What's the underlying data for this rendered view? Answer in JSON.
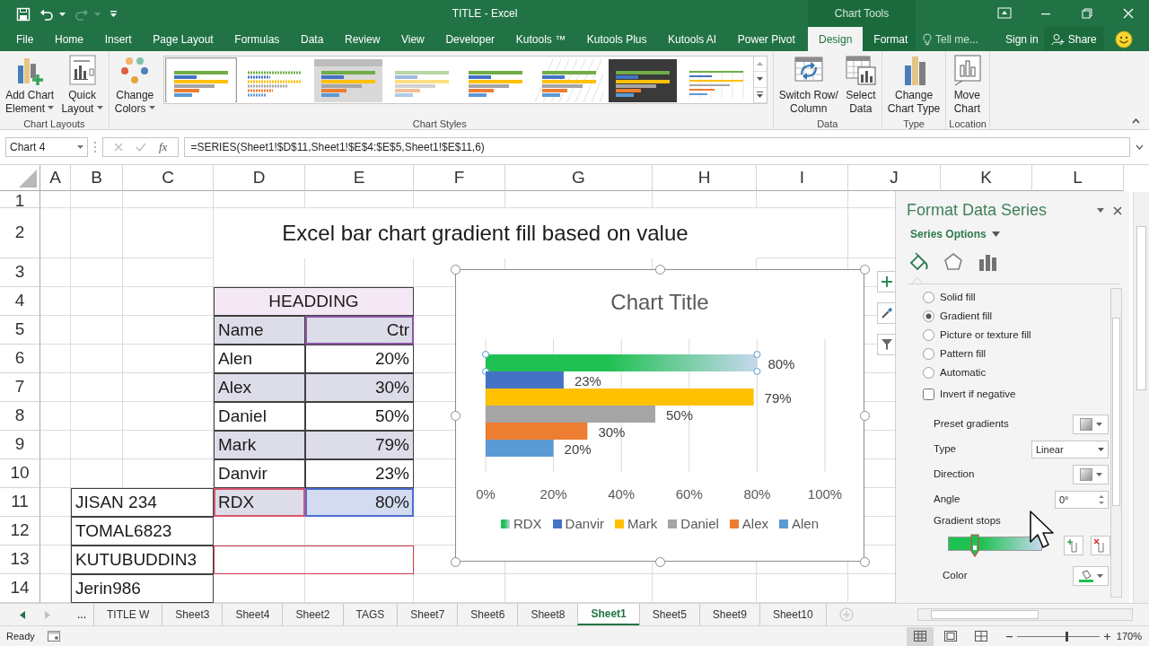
{
  "window": {
    "title": "TITLE - Excel",
    "context_title": "Chart Tools"
  },
  "quick_access": [
    {
      "kind": "save",
      "disabled": false
    },
    {
      "kind": "undo",
      "disabled": false
    },
    {
      "kind": "redo",
      "disabled": true
    },
    {
      "kind": "customize",
      "disabled": false
    }
  ],
  "window_controls": [
    {
      "kind": "ribbon-display"
    },
    {
      "kind": "minimize"
    },
    {
      "kind": "restore"
    },
    {
      "kind": "close"
    }
  ],
  "tabs": [
    {
      "label": "File",
      "kind": "file",
      "selected": false
    },
    {
      "label": "Home",
      "kind": "normal",
      "selected": false
    },
    {
      "label": "Insert",
      "kind": "normal",
      "selected": false
    },
    {
      "label": "Page Layout",
      "kind": "normal",
      "selected": false
    },
    {
      "label": "Formulas",
      "kind": "normal",
      "selected": false
    },
    {
      "label": "Data",
      "kind": "normal",
      "selected": false
    },
    {
      "label": "Review",
      "kind": "normal",
      "selected": false
    },
    {
      "label": "View",
      "kind": "normal",
      "selected": false
    },
    {
      "label": "Developer",
      "kind": "normal",
      "selected": false
    },
    {
      "label": "Kutools ™",
      "kind": "normal",
      "selected": false
    },
    {
      "label": "Kutools Plus",
      "kind": "normal",
      "selected": false
    },
    {
      "label": "Kutools AI",
      "kind": "normal",
      "selected": false
    },
    {
      "label": "Power Pivot",
      "kind": "normal",
      "selected": false
    },
    {
      "label": "Design",
      "kind": "context",
      "selected": true
    },
    {
      "label": "Format",
      "kind": "context",
      "selected": false
    }
  ],
  "tell_me": {
    "placeholder": "Tell me..."
  },
  "sign_in": "Sign in",
  "share": "Share",
  "ribbon": {
    "groups": [
      {
        "label": "Chart Layouts",
        "buttons": [
          {
            "kind": "add-element",
            "lines": [
              "Add Chart",
              "Element"
            ],
            "dropdown": true
          },
          {
            "kind": "quick-layout",
            "lines": [
              "Quick",
              "Layout"
            ],
            "dropdown": true
          }
        ]
      },
      {
        "label": "Chart Styles",
        "buttons": [
          {
            "kind": "change-colors",
            "lines": [
              "Change",
              "Colors"
            ],
            "dropdown": true
          }
        ],
        "gallery": [
          {
            "kind": "white",
            "selected": true
          },
          {
            "kind": "dotted",
            "selected": false
          },
          {
            "kind": "grey",
            "selected": false
          },
          {
            "kind": "pale",
            "selected": false
          },
          {
            "kind": "white",
            "selected": false
          },
          {
            "kind": "hatched",
            "selected": false
          },
          {
            "kind": "dark",
            "selected": false
          },
          {
            "kind": "thin",
            "selected": false
          }
        ]
      },
      {
        "label": "Data",
        "buttons": [
          {
            "kind": "switch-row",
            "lines": [
              "Switch Row/",
              "Column"
            ],
            "dropdown": false
          },
          {
            "kind": "select-data",
            "lines": [
              "Select",
              "Data"
            ],
            "dropdown": false
          }
        ]
      },
      {
        "label": "Type",
        "buttons": [
          {
            "kind": "change-type",
            "lines": [
              "Change",
              "Chart Type"
            ],
            "dropdown": false
          }
        ]
      },
      {
        "label": "Location",
        "buttons": [
          {
            "kind": "move-chart",
            "lines": [
              "Move",
              "Chart"
            ],
            "dropdown": false
          }
        ]
      }
    ]
  },
  "formula_bar": {
    "name_box": "Chart 4",
    "function_button": "fx",
    "formula": "=SERIES(Sheet1!$D$11,Sheet1!$E$4:$E$5,Sheet1!$E$11,6)"
  },
  "sheet": {
    "columns": [
      "A",
      "B",
      "C",
      "D",
      "E",
      "F",
      "G",
      "H",
      "I",
      "J",
      "K",
      "L"
    ],
    "rows": [
      "1",
      "2",
      "3",
      "4",
      "5",
      "6",
      "7",
      "8",
      "9",
      "10",
      "11",
      "12",
      "13",
      "14"
    ],
    "title": "Excel bar chart gradient fill based on value",
    "table": {
      "heading": "HEADDING",
      "columns": [
        "Name",
        "Ctr"
      ],
      "category_selected": true,
      "rows": [
        {
          "name": "Alen",
          "value": "20%",
          "band": false,
          "series_selected": false
        },
        {
          "name": "Alex",
          "value": "30%",
          "band": true,
          "series_selected": false
        },
        {
          "name": "Daniel",
          "value": "50%",
          "band": false,
          "series_selected": false
        },
        {
          "name": "Mark",
          "value": "79%",
          "band": true,
          "series_selected": false
        },
        {
          "name": "Danvir",
          "value": "23%",
          "band": false,
          "series_selected": false
        },
        {
          "name": "RDX",
          "value": "80%",
          "band": true,
          "series_selected": true
        }
      ]
    },
    "side_list": [
      "JISAN 234",
      "TOMAL6823",
      "KUTUBUDDIN3",
      "Jerin986"
    ]
  },
  "chart": {
    "chart_data": {
      "type": "bar",
      "orientation": "horizontal",
      "title": "Chart Title",
      "series": [
        {
          "name": "RDX",
          "color": "#1fc152",
          "values": [
            0.8
          ]
        },
        {
          "name": "Danvir",
          "color": "#4472c4",
          "values": [
            0.23
          ]
        },
        {
          "name": "Mark",
          "color": "#ffc000",
          "values": [
            0.79
          ]
        },
        {
          "name": "Daniel",
          "color": "#a5a5a5",
          "values": [
            0.5
          ]
        },
        {
          "name": "Alex",
          "color": "#ed7d31",
          "values": [
            0.3
          ]
        },
        {
          "name": "Alen",
          "color": "#5b9bd5",
          "values": [
            0.2
          ]
        }
      ],
      "xlim": [
        0,
        1
      ],
      "xticks": [
        {
          "value": 0,
          "label": "0%"
        },
        {
          "value": 0.2,
          "label": "20%"
        },
        {
          "value": 0.4,
          "label": "40%"
        },
        {
          "value": 0.6,
          "label": "60%"
        },
        {
          "value": 0.8,
          "label": "80%"
        },
        {
          "value": 1,
          "label": "100%"
        }
      ],
      "grid": true,
      "legend": "bottom",
      "value_labels": [
        "80%",
        "23%",
        "79%",
        "50%",
        "30%",
        "20%"
      ]
    },
    "series_styles": [
      {
        "kind": "gradient",
        "selected": true
      },
      {
        "kind": "solid",
        "selected": false
      },
      {
        "kind": "solid",
        "selected": false
      },
      {
        "kind": "solid",
        "selected": false
      },
      {
        "kind": "solid",
        "selected": false
      },
      {
        "kind": "solid",
        "selected": false
      }
    ],
    "selected": true,
    "buttons": [
      {
        "kind": "add"
      },
      {
        "kind": "style"
      },
      {
        "kind": "filter"
      }
    ]
  },
  "pane": {
    "title": "Format Data Series",
    "subtitle": "Series Options",
    "tabs": [
      {
        "kind": "fill",
        "selected": true
      },
      {
        "kind": "effects",
        "selected": false
      },
      {
        "kind": "options",
        "selected": false
      }
    ],
    "fill_options": [
      {
        "label": "Solid fill",
        "selected": false
      },
      {
        "label": "Gradient fill",
        "selected": true
      },
      {
        "label": "Picture or texture fill",
        "selected": false
      },
      {
        "label": "Pattern fill",
        "selected": false
      },
      {
        "label": "Automatic",
        "selected": false
      }
    ],
    "invert": {
      "label": "Invert if negative",
      "checked": false
    },
    "fields": [
      {
        "kind": "swatch",
        "label": "Preset gradients"
      },
      {
        "kind": "select",
        "label": "Type",
        "value": "Linear"
      },
      {
        "kind": "swatch",
        "label": "Direction"
      },
      {
        "kind": "spin",
        "label": "Angle",
        "value": "0°"
      }
    ],
    "gradient_stops": {
      "label": "Gradient stops",
      "stops": [
        {
          "level": 0.29,
          "selected": true
        }
      ]
    },
    "color": {
      "label": "Color"
    }
  },
  "sheet_tabs": {
    "more": "...",
    "tabs": [
      {
        "label": "TITLE W",
        "selected": false
      },
      {
        "label": "Sheet3",
        "selected": false
      },
      {
        "label": "Sheet4",
        "selected": false
      },
      {
        "label": "Sheet2",
        "selected": false
      },
      {
        "label": "TAGS",
        "selected": false
      },
      {
        "label": "Sheet7",
        "selected": false
      },
      {
        "label": "Sheet6",
        "selected": false
      },
      {
        "label": "Sheet8",
        "selected": false
      },
      {
        "label": "Sheet1",
        "selected": true
      },
      {
        "label": "Sheet5",
        "selected": false
      },
      {
        "label": "Sheet9",
        "selected": false
      },
      {
        "label": "Sheet10",
        "selected": false
      }
    ]
  },
  "status_bar": {
    "text": "Ready",
    "views": [
      {
        "kind": "normal",
        "selected": true
      },
      {
        "kind": "page-layout",
        "selected": false
      },
      {
        "kind": "page-break",
        "selected": false
      }
    ],
    "zoom_slider": {
      "level": 0.6
    },
    "zoom": "170%"
  }
}
